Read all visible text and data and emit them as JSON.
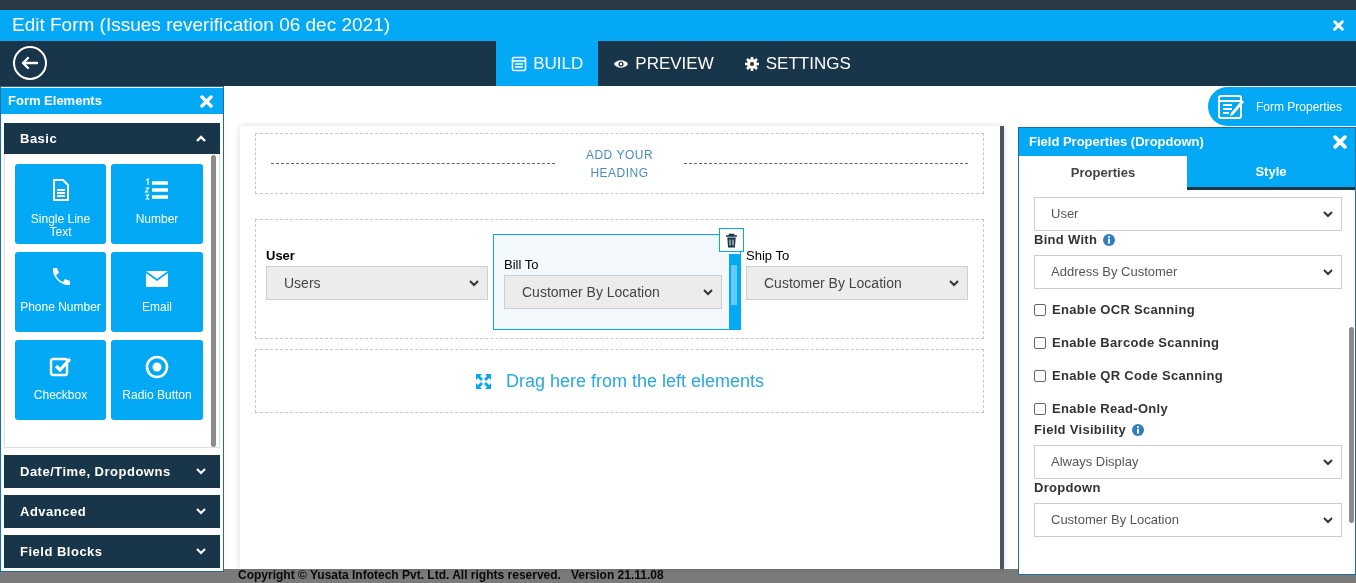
{
  "background": {
    "footer": [
      "Copyright © Yusata Infotech Pvt. Ltd. All rights reserved.",
      "Version 21.11.08"
    ]
  },
  "window": {
    "title": "Edit Form (Issues reverification 06 dec 2021)"
  },
  "nav_tabs": [
    {
      "label": "BUILD",
      "kind": "build",
      "selected": true
    },
    {
      "label": "PREVIEW",
      "kind": "preview",
      "selected": false
    },
    {
      "label": "SETTINGS",
      "kind": "settings",
      "selected": false
    }
  ],
  "form_elements": {
    "title": "Form Elements",
    "sections": [
      {
        "title": "Basic",
        "expanded": true,
        "items": [
          {
            "label": "Single Line Text",
            "kind": "text"
          },
          {
            "label": "Number",
            "kind": "number"
          },
          {
            "label": "Phone Number",
            "kind": "phone"
          },
          {
            "label": "Email",
            "kind": "email"
          },
          {
            "label": "Checkbox",
            "kind": "checkbox"
          },
          {
            "label": "Radio Button",
            "kind": "radio"
          }
        ]
      },
      {
        "title": "Date/Time, Dropdowns",
        "expanded": false
      },
      {
        "title": "Advanced",
        "expanded": false
      },
      {
        "title": "Field Blocks",
        "expanded": false
      }
    ]
  },
  "canvas": {
    "heading": "ADD YOUR HEADING",
    "fields": [
      {
        "label": "User",
        "value": "Users",
        "selected": false
      },
      {
        "label": "Bill To",
        "value": "Customer By Location",
        "selected": true
      },
      {
        "label": "Ship To",
        "value": "Customer By Location",
        "selected": false
      }
    ],
    "drop_zone": "Drag here from the left elements"
  },
  "form_properties_button": "Form Properties",
  "field_properties": {
    "title": "Field Properties (Dropdown)",
    "tabs": [
      {
        "label": "Properties",
        "selected": true
      },
      {
        "label": "Style",
        "selected": false
      }
    ],
    "items": [
      {
        "kind": "select",
        "value": "User"
      },
      {
        "kind": "select",
        "label": "Bind With",
        "info": true,
        "value": "Address By Customer"
      },
      {
        "kind": "checkbox",
        "label": "Enable OCR Scanning",
        "checked": false
      },
      {
        "kind": "checkbox",
        "label": "Enable Barcode Scanning",
        "checked": false
      },
      {
        "kind": "checkbox",
        "label": "Enable QR Code Scanning",
        "checked": false
      },
      {
        "kind": "checkbox",
        "label": "Enable Read-Only",
        "checked": false
      },
      {
        "kind": "select",
        "label": "Field Visibility",
        "info": true,
        "value": "Always Display"
      },
      {
        "kind": "select",
        "label": "Dropdown",
        "info": false,
        "value": "Customer By Location"
      }
    ]
  }
}
